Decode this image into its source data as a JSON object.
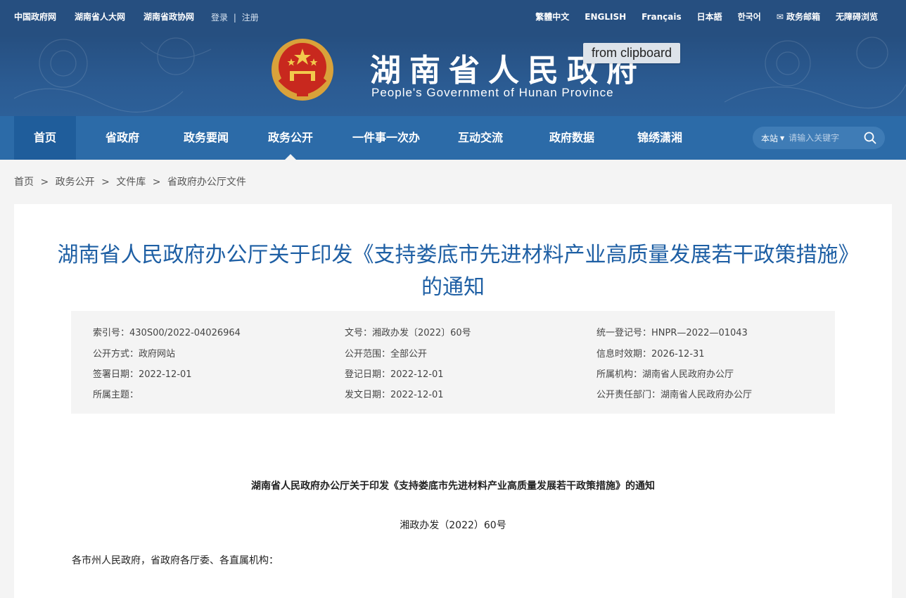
{
  "topbar": {
    "links_left": [
      "中国政府网",
      "湖南省人大网",
      "湖南省政协网"
    ],
    "login": "登录",
    "separator": "|",
    "register": "注册",
    "links_right": [
      "繁體中文",
      "ENGLISH",
      "Français",
      "日本語",
      "한국어",
      "✉ 政务邮箱",
      "无障碍浏览"
    ]
  },
  "banner": {
    "title": "湖南省人民政府",
    "subtitle": "People's Government of Hunan Province"
  },
  "tooltip": "from clipboard",
  "nav": {
    "items": [
      "首页",
      "省政府",
      "政务要闻",
      "政务公开",
      "一件事一次办",
      "互动交流",
      "政府数据",
      "锦绣潇湘"
    ],
    "active_index": 3
  },
  "search": {
    "scope": "本站",
    "placeholder": "请输入关键字"
  },
  "breadcrumb": {
    "parts": [
      "首页",
      "政务公开",
      "文件库",
      "省政府办公厅文件"
    ],
    "separator": ">"
  },
  "document": {
    "title": "湖南省人民政府办公厅关于印发《支持娄底市先进材料产业高质量发展若干政策措施》的通知",
    "meta": {
      "index_no": "索引号：430S00/2022-04026964",
      "doc_no": "文号：湘政办发〔2022〕60号",
      "reg_no": "统一登记号：HNPR—2022—01043",
      "publish_mode": "公开方式：政府网站",
      "publish_scope": "公开范围：全部公开",
      "validity": "信息时效期：2026-12-31",
      "sign_date": "签署日期：2022-12-01",
      "register_date": "登记日期：2022-12-01",
      "agency": "所属机构：湖南省人民政府办公厅",
      "topic": "所属主题：",
      "issue_date": "发文日期：2022-12-01",
      "responsible_dept": "公开责任部门：湖南省人民政府办公厅"
    },
    "body_title": "湖南省人民政府办公厅关于印发《支持娄底市先进材料产业高质量发展若干政策措施》的通知",
    "body_doc_no": "湘政办发（2022）60号",
    "salutation": "各市州人民政府，省政府各厅委、各直属机构："
  },
  "colors": {
    "header_bg": "#264f80",
    "nav_bg": "#2c6ba8",
    "title_blue": "#1e5fa4"
  }
}
